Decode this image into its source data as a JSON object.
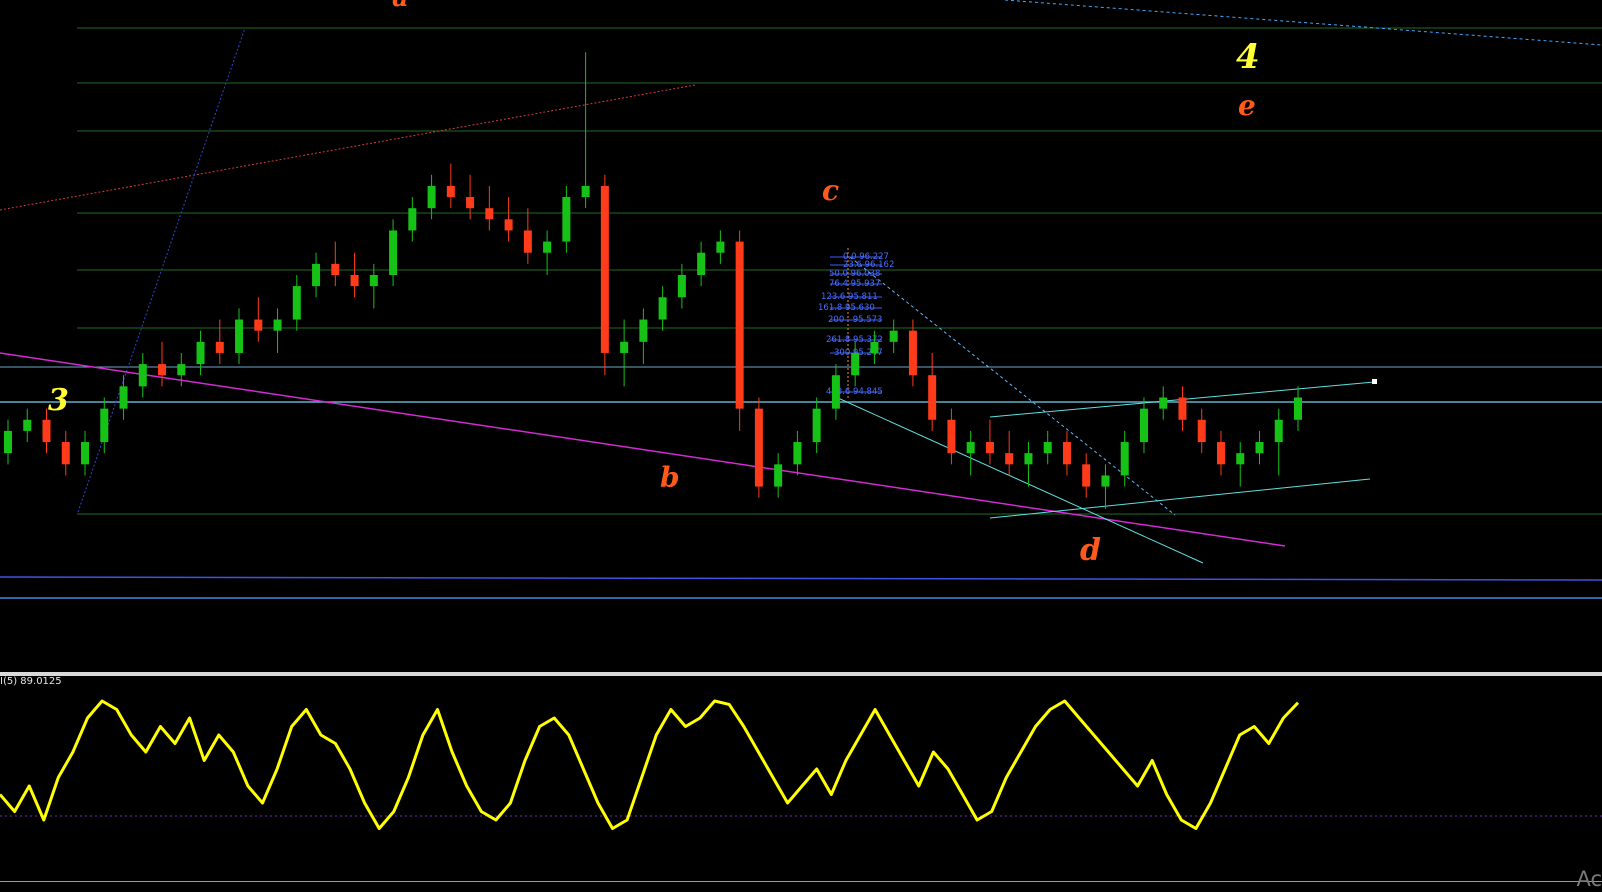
{
  "chart_data": [
    {
      "type": "candlestick",
      "panel": "price",
      "title": "",
      "colors": {
        "up": "#17c217",
        "down": "#ff3b1a"
      },
      "ohlc": [
        [
          94,
          97,
          93,
          96
        ],
        [
          96,
          98,
          95,
          97
        ],
        [
          97,
          98,
          94,
          95
        ],
        [
          95,
          96,
          92,
          93
        ],
        [
          93,
          96,
          92,
          95
        ],
        [
          95,
          99,
          94,
          98
        ],
        [
          98,
          101,
          97,
          100
        ],
        [
          100,
          103,
          99,
          102
        ],
        [
          102,
          104,
          100,
          101
        ],
        [
          101,
          103,
          100,
          102
        ],
        [
          102,
          105,
          101,
          104
        ],
        [
          104,
          106,
          102,
          103
        ],
        [
          103,
          107,
          102,
          106
        ],
        [
          106,
          108,
          104,
          105
        ],
        [
          105,
          107,
          103,
          106
        ],
        [
          106,
          110,
          105,
          109
        ],
        [
          109,
          112,
          108,
          111
        ],
        [
          111,
          113,
          109,
          110
        ],
        [
          110,
          112,
          108,
          109
        ],
        [
          109,
          111,
          107,
          110
        ],
        [
          110,
          115,
          109,
          114
        ],
        [
          114,
          117,
          113,
          116
        ],
        [
          116,
          119,
          115,
          118
        ],
        [
          118,
          120,
          116,
          117
        ],
        [
          117,
          119,
          115,
          116
        ],
        [
          116,
          118,
          114,
          115
        ],
        [
          115,
          117,
          113,
          114
        ],
        [
          114,
          116,
          111,
          112
        ],
        [
          112,
          114,
          110,
          113
        ],
        [
          113,
          118,
          112,
          117
        ],
        [
          117,
          130,
          116,
          118
        ],
        [
          118,
          119,
          101,
          103
        ],
        [
          103,
          106,
          100,
          104
        ],
        [
          104,
          107,
          102,
          106
        ],
        [
          106,
          109,
          105,
          108
        ],
        [
          108,
          111,
          107,
          110
        ],
        [
          110,
          113,
          109,
          112
        ],
        [
          112,
          114,
          111,
          113
        ],
        [
          113,
          114,
          96,
          98
        ],
        [
          98,
          99,
          90,
          91
        ],
        [
          91,
          94,
          90,
          93
        ],
        [
          93,
          96,
          92,
          95
        ],
        [
          95,
          99,
          94,
          98
        ],
        [
          98,
          102,
          97,
          101
        ],
        [
          101,
          104,
          100,
          103
        ],
        [
          103,
          105,
          102,
          104
        ],
        [
          104,
          106,
          103,
          105
        ],
        [
          105,
          106,
          100,
          101
        ],
        [
          101,
          103,
          96,
          97
        ],
        [
          97,
          98,
          93,
          94
        ],
        [
          94,
          96,
          92,
          95
        ],
        [
          95,
          97,
          93,
          94
        ],
        [
          94,
          96,
          92,
          93
        ],
        [
          93,
          95,
          91,
          94
        ],
        [
          94,
          96,
          93,
          95
        ],
        [
          95,
          96,
          92,
          93
        ],
        [
          93,
          94,
          90,
          91
        ],
        [
          91,
          93,
          89,
          92
        ],
        [
          92,
          96,
          91,
          95
        ],
        [
          95,
          99,
          94,
          98
        ],
        [
          98,
          100,
          97,
          99
        ],
        [
          99,
          100,
          96,
          97
        ],
        [
          97,
          98,
          94,
          95
        ],
        [
          95,
          96,
          92,
          93
        ],
        [
          93,
          95,
          91,
          94
        ],
        [
          94,
          96,
          93,
          95
        ],
        [
          95,
          98,
          92,
          97
        ],
        [
          97,
          100,
          96,
          99
        ]
      ]
    },
    {
      "type": "line",
      "panel": "oscillator",
      "title": "",
      "colors": {
        "line": "#ffff00"
      },
      "ylim": [
        0,
        100
      ],
      "values": [
        35,
        25,
        40,
        20,
        45,
        60,
        80,
        90,
        85,
        70,
        60,
        75,
        65,
        80,
        55,
        70,
        60,
        40,
        30,
        50,
        75,
        85,
        70,
        65,
        50,
        30,
        15,
        25,
        45,
        70,
        85,
        60,
        40,
        25,
        20,
        30,
        55,
        75,
        80,
        70,
        50,
        30,
        15,
        20,
        45,
        70,
        85,
        75,
        80,
        90,
        88,
        75,
        60,
        45,
        30,
        40,
        50,
        35,
        55,
        70,
        85,
        70,
        55,
        40,
        60,
        50,
        35,
        20,
        25,
        45,
        60,
        75,
        85,
        90,
        80,
        70,
        60,
        50,
        40,
        55,
        35,
        20,
        15,
        30,
        50,
        70,
        75,
        65,
        80,
        89
      ]
    }
  ],
  "osc_indicator_label": "I(5) 89.0125",
  "price_levels": {
    "fib_labels": [
      "0.0 96.227",
      "23.6 96.162",
      "50.0 96.038",
      "76.4 95.937",
      "123.6 95.811",
      "161.8 95.630",
      "200 - 95.573",
      "261.8 95.372",
      "300 95.247",
      "423.6 94.845"
    ]
  },
  "wave_labels": {
    "wave_3": "3",
    "wave_4": "4",
    "wave_a": "a",
    "wave_b": "b",
    "wave_c": "c",
    "wave_d": "d",
    "wave_e": "e"
  },
  "watermark_text": "Ac"
}
